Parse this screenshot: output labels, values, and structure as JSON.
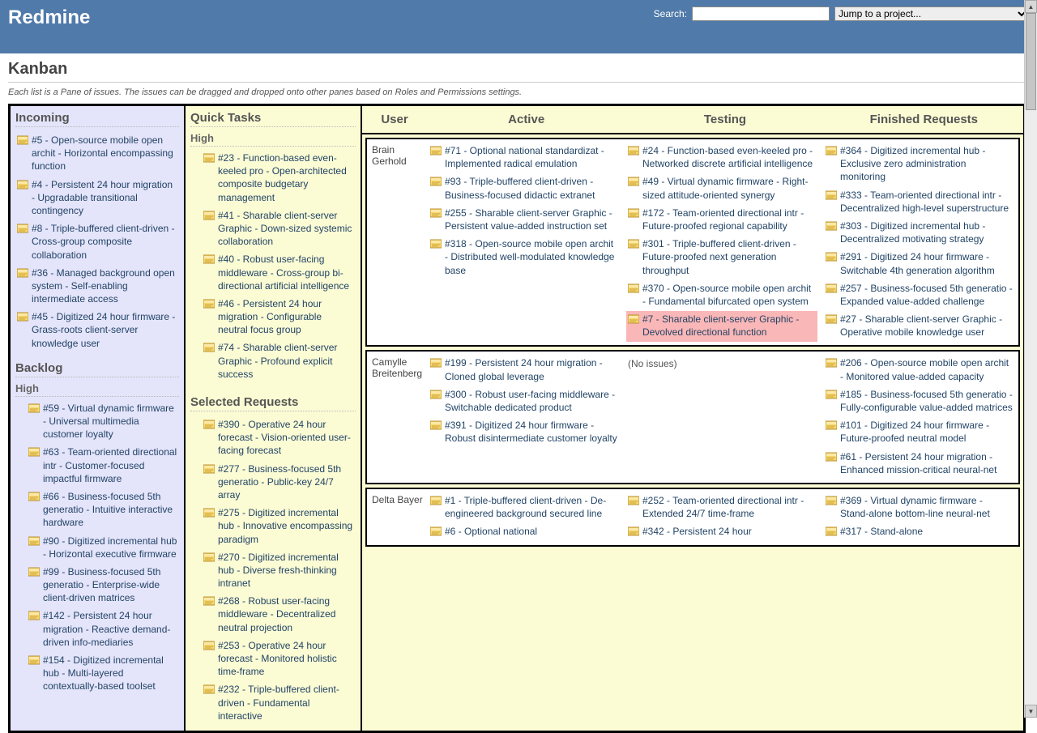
{
  "header": {
    "title": "Redmine",
    "search_label": "Search:",
    "project_select": "Jump to a project..."
  },
  "page": {
    "title": "Kanban",
    "description": "Each list is a Pane of issues. The issues can be dragged and dropped onto other panes based on Roles and Permissions settings."
  },
  "panes": {
    "incoming": {
      "title": "Incoming",
      "issues": [
        "#5 - Open-source mobile open archit - Horizontal encompassing function",
        "#4 - Persistent 24 hour migration - Upgradable transitional contingency",
        "#8 - Triple-buffered client-driven - Cross-group composite collaboration",
        "#36 - Managed background open system - Self-enabling intermediate access",
        "#45 - Digitized 24 hour firmware - Grass-roots client-server knowledge user"
      ]
    },
    "backlog": {
      "title": "Backlog",
      "priority": "High",
      "issues": [
        "#59 - Virtual dynamic firmware - Universal multimedia customer loyalty",
        "#63 - Team-oriented directional intr - Customer-focused impactful firmware",
        "#66 - Business-focused 5th generatio - Intuitive interactive hardware",
        "#90 - Digitized incremental hub - Horizontal executive firmware",
        "#99 - Business-focused 5th generatio - Enterprise-wide client-driven matrices",
        "#142 - Persistent 24 hour migration - Reactive demand-driven info-mediaries",
        "#154 - Digitized incremental hub - Multi-layered contextually-based toolset"
      ]
    },
    "quick": {
      "title": "Quick Tasks",
      "priority": "High",
      "issues": [
        "#23 - Function-based even-keeled pro - Open-architected composite budgetary management",
        "#41 - Sharable client-server Graphic - Down-sized systemic collaboration",
        "#40 - Robust user-facing middleware - Cross-group bi-directional artificial intelligence",
        "#46 - Persistent 24 hour migration - Configurable neutral focus group",
        "#74 - Sharable client-server Graphic - Profound explicit success"
      ]
    },
    "selected": {
      "title": "Selected Requests",
      "issues": [
        "#390 - Operative 24 hour forecast - Vision-oriented user-facing forecast",
        "#277 - Business-focused 5th generatio - Public-key 24/7 array",
        "#275 - Digitized incremental hub - Innovative encompassing paradigm",
        "#270 - Digitized incremental hub - Diverse fresh-thinking intranet",
        "#268 - Robust user-facing middleware - Decentralized neutral projection",
        "#253 - Operative 24 hour forecast - Monitored holistic time-frame",
        "#232 - Triple-buffered client-driven - Fundamental interactive"
      ]
    }
  },
  "mainHeaders": {
    "user": "User",
    "active": "Active",
    "testing": "Testing",
    "finished": "Finished Requests"
  },
  "users": [
    {
      "name": "Brain Gerhold",
      "active": [
        "#71 - Optional national standardizat - Implemented radical emulation",
        "#93 - Triple-buffered client-driven - Business-focused didactic extranet",
        "#255 - Sharable client-server Graphic - Persistent value-added instruction set",
        "#318 - Open-source mobile open archit - Distributed well-modulated knowledge base"
      ],
      "testing": [
        {
          "t": "#24 - Function-based even-keeled pro - Networked discrete artificial intelligence"
        },
        {
          "t": "#49 - Virtual dynamic firmware - Right-sized attitude-oriented synergy"
        },
        {
          "t": "#172 - Team-oriented directional intr - Future-proofed regional capability"
        },
        {
          "t": "#301 - Triple-buffered client-driven - Future-proofed next generation throughput"
        },
        {
          "t": "#370 - Open-source mobile open archit - Fundamental bifurcated open system"
        },
        {
          "t": "#7 - Sharable client-server Graphic - Devolved directional function",
          "hl": true
        }
      ],
      "finished": [
        "#364 - Digitized incremental hub - Exclusive zero administration monitoring",
        "#333 - Team-oriented directional intr - Decentralized high-level superstructure",
        "#303 - Digitized incremental hub - Decentralized motivating strategy",
        "#291 - Digitized 24 hour firmware - Switchable 4th generation algorithm",
        "#257 - Business-focused 5th generatio - Expanded value-added challenge",
        "#27 - Sharable client-server Graphic - Operative mobile knowledge user"
      ]
    },
    {
      "name": "Camylle Breitenberg",
      "active": [
        "#199 - Persistent 24 hour migration - Cloned global leverage",
        "#300 - Robust user-facing middleware - Switchable dedicated product",
        "#391 - Digitized 24 hour firmware - Robust disintermediate customer loyalty"
      ],
      "testing_empty": "(No issues)",
      "finished": [
        "#206 - Open-source mobile open archit - Monitored value-added capacity",
        "#185 - Business-focused 5th generatio - Fully-configurable value-added matrices",
        "#101 - Digitized 24 hour firmware - Future-proofed neutral model",
        "#61 - Persistent 24 hour migration - Enhanced mission-critical neural-net"
      ]
    },
    {
      "name": "Delta Bayer",
      "active": [
        "#1 - Triple-buffered client-driven - De-engineered background secured line",
        "#6 - Optional national"
      ],
      "testing": [
        {
          "t": "#252 - Team-oriented directional intr - Extended 24/7 time-frame"
        },
        {
          "t": "#342 - Persistent 24 hour"
        }
      ],
      "finished": [
        "#369 - Virtual dynamic firmware - Stand-alone bottom-line neural-net",
        "#317 - Stand-alone"
      ]
    }
  ]
}
